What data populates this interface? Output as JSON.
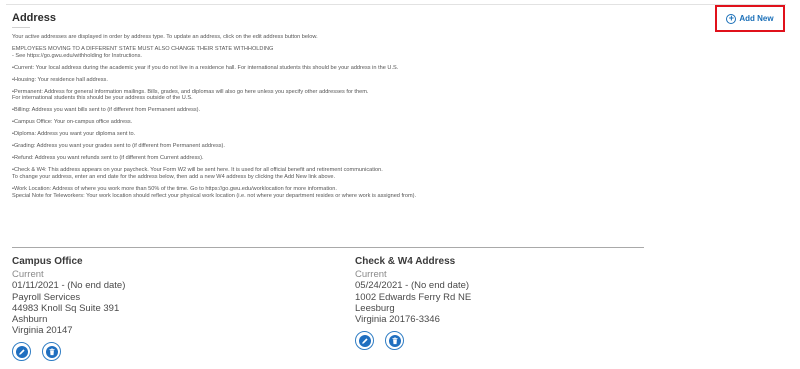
{
  "section": {
    "title": "Address",
    "add_new_label": "Add New"
  },
  "instructions": [
    "Your active addresses are displayed in order by address type.  To update an address, click on the edit address button below.",
    "EMPLOYEES MOVING TO A DIFFERENT STATE MUST ALSO CHANGE THEIR STATE WITHHOLDING",
    "- See https://go.gwu.edu/withholding for Instructions.",
    "•Current: Your local address during the academic year if you do not live in a residence hall. For international students this should be your address in the U.S.",
    "•Housing: Your residence hall address.",
    "•Permanent: Address for general information mailings. Bills, grades, and diplomas will also go here unless you specify other addresses for them.",
    "For international students this should be your address outside of the U.S.",
    "•Billing: Address you want bills sent to (if different from Permanent address).",
    "•Campus Office: Your on-campus office address.",
    "•Diploma: Address you want your diploma sent to.",
    "•Grading: Address you want your grades sent to (if different from Permanent address).",
    "•Refund: Address you want refunds sent to (if different from Current address).",
    "•Check & W4: This address appears on your paycheck. Your Form W2 will be sent here. It is used for all official benefit and retirement communication.",
    "To change your address, enter an end date for the address below, then add a new W4 address by clicking the Add New link above.",
    "•Work Location: Address of where you work more than 50% of the time. Go to https://go.gwu.edu/worklocation for more information.",
    "Special Note for Teleworkers: Your work location should reflect your physical work location (i.e. not where your department resides or where work is assigned from)."
  ],
  "addresses": [
    {
      "type": "Campus Office",
      "status": "Current",
      "dates": "01/11/2021 - (No end date)",
      "line1": "Payroll Services",
      "line2": "44983 Knoll Sq Suite 391",
      "city": "Ashburn",
      "state_zip": "Virginia 20147"
    },
    {
      "type": "Check & W4 Address",
      "status": "Current",
      "dates": "05/24/2021 - (No end date)",
      "line1": "1002 Edwards Ferry Rd NE",
      "city": "Leesburg",
      "state_zip": "Virginia 20176-3346"
    }
  ],
  "icons": {
    "add": "plus-circle-icon",
    "edit": "pencil-icon",
    "delete": "trash-icon"
  },
  "colors": {
    "link": "#1a6fb8",
    "highlight_box": "#e0111b",
    "action_button": "#1f6fc0"
  }
}
